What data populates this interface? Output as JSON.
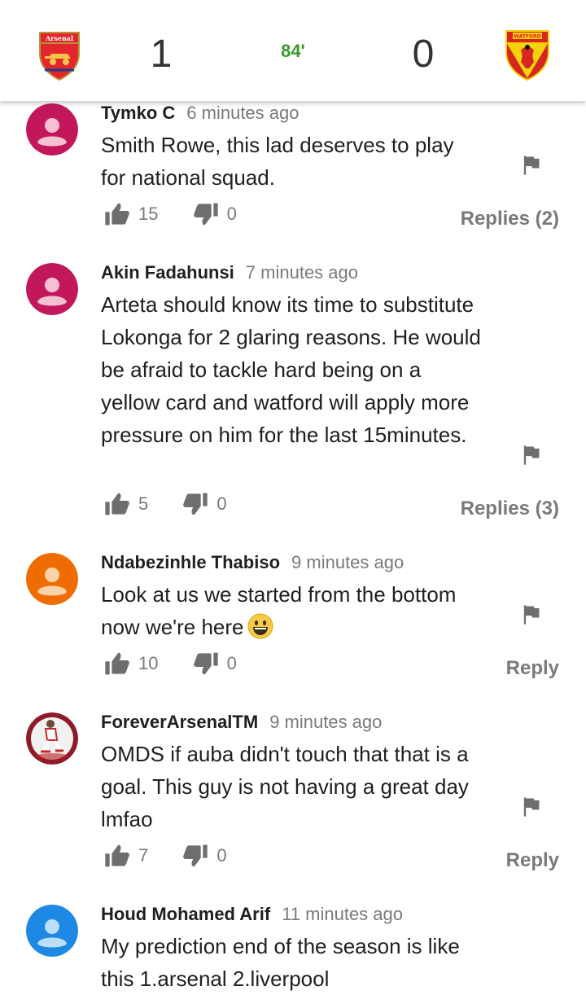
{
  "match": {
    "home_team": "Arsenal",
    "away_team": "Watford",
    "home_score": "1",
    "away_score": "0",
    "minute": "84'"
  },
  "colors": {
    "minute": "#3a9a27",
    "arsenal_red": "#e3262b",
    "watford_yellow": "#f5d20a"
  },
  "comments": [
    {
      "author": "Tymko C",
      "time": "6 minutes ago",
      "text": "Smith Rowe, this lad deserves to play for national squad.",
      "likes": "15",
      "dislikes": "0",
      "replies_label": "Replies (2)",
      "avatar_color": "#c2185b"
    },
    {
      "author": "Akin Fadahunsi",
      "time": "7 minutes ago",
      "text": "Arteta should know its time to substitute Lokonga for 2 glaring reasons. He would be afraid to tackle hard being on a yellow card and watford will apply more pressure on him for the last 15minutes.",
      "likes": "5",
      "dislikes": "0",
      "replies_label": "Replies (3)",
      "avatar_color": "#c2185b"
    },
    {
      "author": "Ndabezinhle Thabiso",
      "time": "9 minutes ago",
      "text": "Look at us we started from the bottom now we're here",
      "likes": "10",
      "dislikes": "0",
      "replies_label": "Reply",
      "avatar_color": "#ef6c00"
    },
    {
      "author": "ForeverArsenalTM",
      "time": "9 minutes ago",
      "text": "OMDS if auba didn't touch that that is a goal. This guy is not having a great day lmfao",
      "likes": "7",
      "dislikes": "0",
      "replies_label": "Reply",
      "avatar_color": "#8e1b2a"
    },
    {
      "author": "Houd Mohamed Arif",
      "time": "11 minutes ago",
      "text": "My prediction end of the season is like this 1.arsenal 2.liverpool",
      "avatar_color": "#1e88e5"
    }
  ],
  "icons": {
    "like": "thumbs-up-icon",
    "dislike": "thumbs-down-icon",
    "report": "flag-icon",
    "emoji": "grinning-face-emoji"
  }
}
